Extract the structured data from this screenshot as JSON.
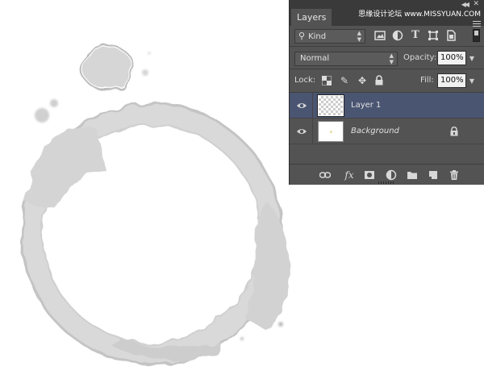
{
  "panel": {
    "tab_label": "Layers",
    "watermark": "思缘设计论坛 www.MISSYUAN.COM"
  },
  "filter": {
    "kind_label": "Kind",
    "icons": [
      "image-filter-icon",
      "adjustment-filter-icon",
      "type-filter-icon",
      "shape-filter-icon",
      "smart-object-filter-icon"
    ]
  },
  "blend": {
    "mode": "Normal",
    "opacity_label": "Opacity:",
    "opacity_value": "100%"
  },
  "lock": {
    "label": "Lock:",
    "fill_label": "Fill:",
    "fill_value": "100%"
  },
  "layers": [
    {
      "name": "Layer 1",
      "selected": true,
      "visible": true,
      "thumbnail": "transparent"
    },
    {
      "name": "Background",
      "selected": false,
      "visible": true,
      "locked": true,
      "thumbnail": "white"
    }
  ],
  "footer": {
    "fx_label": "fx"
  },
  "colors": {
    "panel_bg": "#535353",
    "selected_row": "#4a5572",
    "stain_gray": "#c8c8c8"
  }
}
